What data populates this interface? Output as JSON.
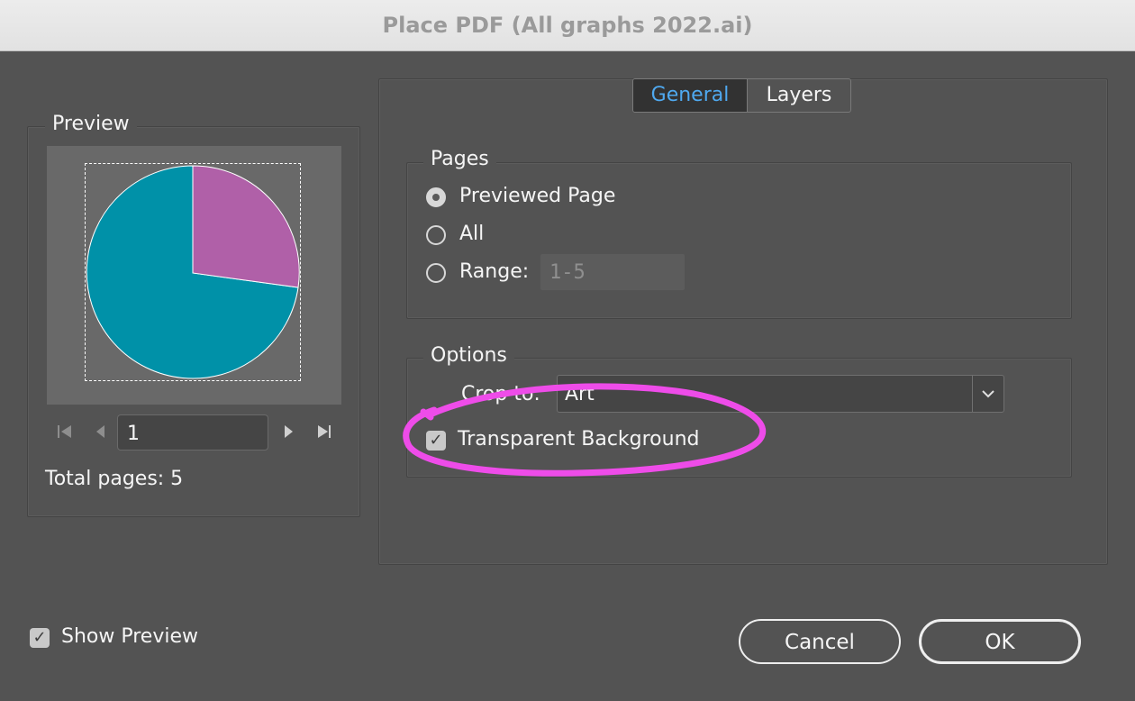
{
  "window": {
    "title": "Place PDF (All graphs 2022.ai)"
  },
  "tabs": {
    "general": "General",
    "layers": "Layers"
  },
  "preview": {
    "legend": "Preview",
    "page_value": "1",
    "total_pages": "Total pages: 5",
    "pie_colors": [
      "#0091a8",
      "#b060a8"
    ],
    "pie_fractions": [
      0.73,
      0.27
    ]
  },
  "pages": {
    "legend": "Pages",
    "previewed_label": "Previewed Page",
    "all_label": "All",
    "range_label": "Range:",
    "range_placeholder": "1-5",
    "selected": "Previewed Page"
  },
  "options": {
    "legend": "Options",
    "crop_label": "Crop to:",
    "crop_value": "Art",
    "transparent_label": "Transparent Background",
    "transparent_checked": true
  },
  "footer": {
    "show_preview_label": "Show Preview",
    "show_preview_checked": true,
    "cancel_label": "Cancel",
    "ok_label": "OK"
  },
  "annotation": {
    "color": "#ee4ce9"
  }
}
